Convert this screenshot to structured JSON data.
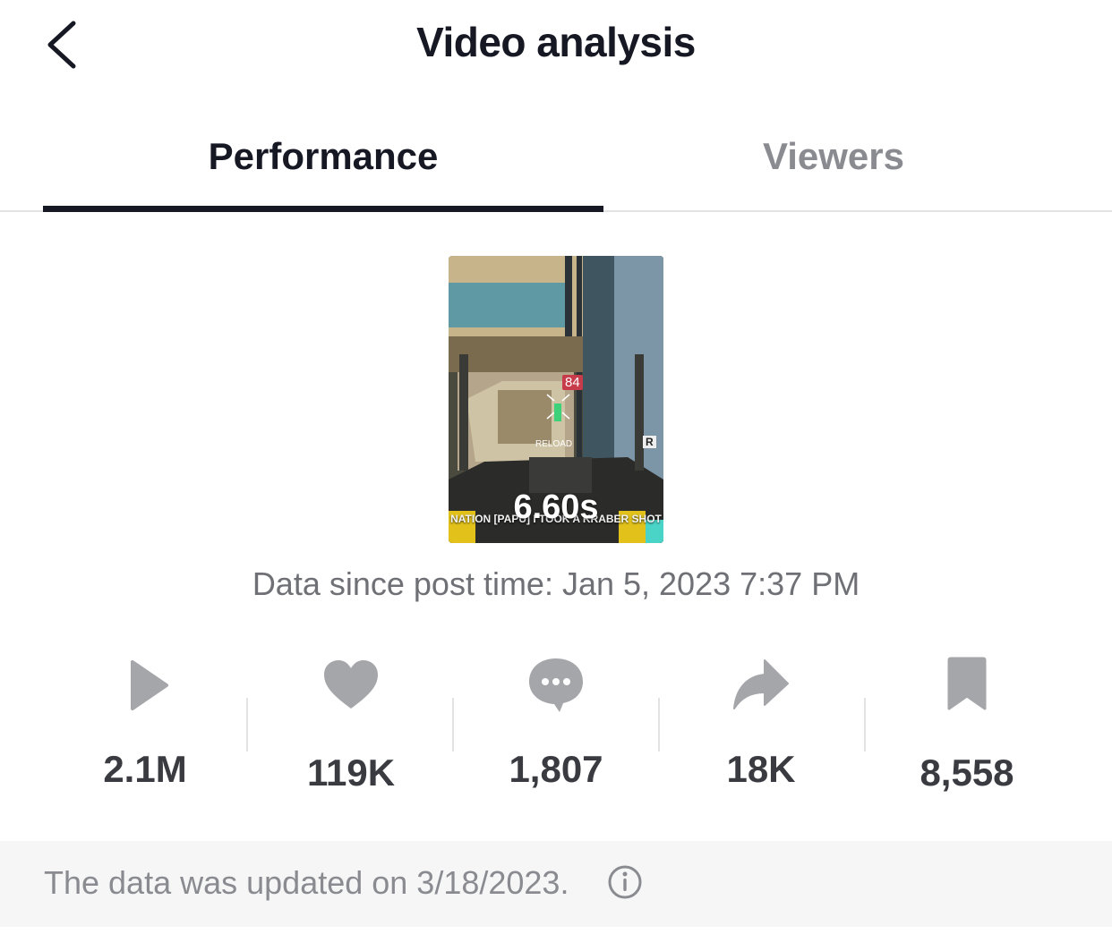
{
  "header": {
    "title": "Video analysis",
    "back_icon": "chevron-left-icon"
  },
  "tabs": [
    {
      "label": "Performance",
      "active": true
    },
    {
      "label": "Viewers",
      "active": false
    }
  ],
  "video": {
    "duration": "6.60s",
    "hud_damage": "84",
    "hud_reload": "RELOAD",
    "hud_key": "R",
    "caption": "NATION [PAPU] I TOOK A KRABER SHOT"
  },
  "post_time": "Data since post time: Jan 5, 2023 7:37 PM",
  "stats": [
    {
      "icon": "play-icon",
      "value": "2.1M"
    },
    {
      "icon": "heart-icon",
      "value": "119K"
    },
    {
      "icon": "comment-icon",
      "value": "1,807"
    },
    {
      "icon": "share-icon",
      "value": "18K"
    },
    {
      "icon": "bookmark-icon",
      "value": "8,558"
    }
  ],
  "footer": {
    "text": "The data was updated on 3/18/2023.",
    "info_icon": "info-icon"
  },
  "colors": {
    "text_primary": "#161823",
    "text_secondary": "#8a8b91",
    "icon_gray": "#a5a6aa",
    "footer_bg": "#f6f6f6"
  }
}
